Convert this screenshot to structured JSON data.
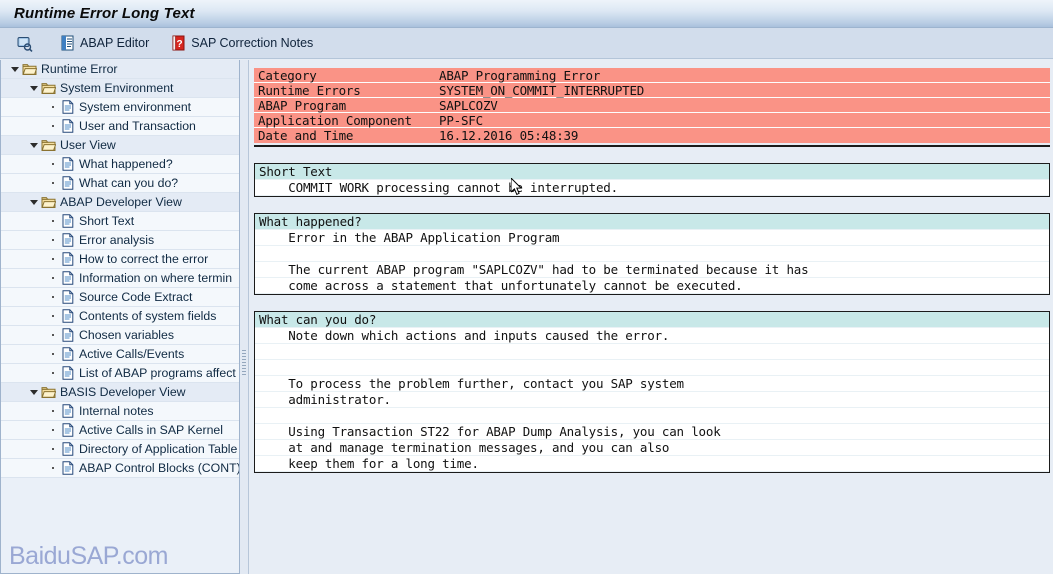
{
  "window": {
    "title": "Runtime Error Long Text"
  },
  "toolbar": {
    "items": [
      {
        "icon": "magnifier-display-icon",
        "label": ""
      },
      {
        "icon": "abap-editor-icon",
        "label": "ABAP Editor"
      },
      {
        "icon": "sap-correction-notes-icon",
        "label": "SAP Correction Notes"
      }
    ]
  },
  "tree": {
    "nodes": [
      {
        "level": 0,
        "type": "folder",
        "expanded": true,
        "label": "Runtime Error"
      },
      {
        "level": 1,
        "type": "folder",
        "expanded": true,
        "label": "System Environment"
      },
      {
        "level": 2,
        "type": "leaf",
        "label": "System environment"
      },
      {
        "level": 2,
        "type": "leaf",
        "label": "User and Transaction"
      },
      {
        "level": 1,
        "type": "folder",
        "expanded": true,
        "label": "User View"
      },
      {
        "level": 2,
        "type": "leaf",
        "label": "What happened?"
      },
      {
        "level": 2,
        "type": "leaf",
        "label": "What can you do?"
      },
      {
        "level": 1,
        "type": "folder",
        "expanded": true,
        "label": "ABAP Developer View"
      },
      {
        "level": 2,
        "type": "leaf",
        "label": "Short Text"
      },
      {
        "level": 2,
        "type": "leaf",
        "label": "Error analysis"
      },
      {
        "level": 2,
        "type": "leaf",
        "label": "How to correct the error"
      },
      {
        "level": 2,
        "type": "leaf",
        "label": "Information on where termin"
      },
      {
        "level": 2,
        "type": "leaf",
        "label": "Source Code Extract"
      },
      {
        "level": 2,
        "type": "leaf",
        "label": "Contents of system fields"
      },
      {
        "level": 2,
        "type": "leaf",
        "label": "Chosen variables"
      },
      {
        "level": 2,
        "type": "leaf",
        "label": "Active Calls/Events"
      },
      {
        "level": 2,
        "type": "leaf",
        "label": "List of ABAP programs affect"
      },
      {
        "level": 1,
        "type": "folder",
        "expanded": true,
        "label": "BASIS Developer View"
      },
      {
        "level": 2,
        "type": "leaf",
        "label": "Internal notes"
      },
      {
        "level": 2,
        "type": "leaf",
        "label": "Active Calls in SAP Kernel"
      },
      {
        "level": 2,
        "type": "leaf",
        "label": "Directory of Application Table"
      },
      {
        "level": 2,
        "type": "leaf",
        "label": "ABAP Control Blocks (CONT)"
      }
    ]
  },
  "summary": {
    "rows": [
      {
        "key": "Category",
        "value": "ABAP Programming Error"
      },
      {
        "key": "Runtime Errors",
        "value": "SYSTEM_ON_COMMIT_INTERRUPTED"
      },
      {
        "key": "ABAP Program",
        "value": "SAPLCOZV"
      },
      {
        "key": "Application Component",
        "value": "PP-SFC"
      },
      {
        "key": "Date and Time",
        "value": "16.12.2016 05:48:39"
      }
    ]
  },
  "sections": [
    {
      "heading": "Short Text",
      "lines": [
        "    COMMIT WORK processing cannot be interrupted."
      ]
    },
    {
      "heading": "What happened?",
      "lines": [
        "    Error in the ABAP Application Program",
        "",
        "    The current ABAP program \"SAPLCOZV\" had to be terminated because it has",
        "    come across a statement that unfortunately cannot be executed."
      ]
    },
    {
      "heading": "What can you do?",
      "lines": [
        "    Note down which actions and inputs caused the error.",
        "",
        "",
        "    To process the problem further, contact you SAP system",
        "    administrator.",
        "",
        "    Using Transaction ST22 for ABAP Dump Analysis, you can look",
        "    at and manage termination messages, and you can also",
        "    keep them for a long time."
      ]
    }
  ],
  "watermark": {
    "text": "BaiduSAP.com"
  },
  "colors": {
    "error_block": "#fa9386",
    "section_heading": "#c8e8e8",
    "titlebar_end": "#a9c0dc",
    "panel_bg": "#e7edf5",
    "watermark": "#9aa8d4"
  }
}
